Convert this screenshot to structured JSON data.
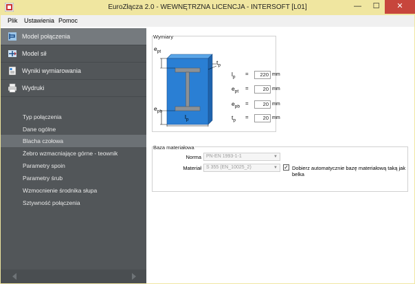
{
  "window": {
    "title": "EuroZłącza 2.0 - WEWNĘTRZNA LICENCJA - INTERSOFT [L01]",
    "minimize": "—",
    "maximize": "☐",
    "close": "✕"
  },
  "menu": [
    "Plik",
    "Ustawienia",
    "Pomoc"
  ],
  "sidebar": {
    "nav": [
      {
        "label": "Model połączenia",
        "icon": "connection-model-icon",
        "active": true
      },
      {
        "label": "Model sił",
        "icon": "forces-model-icon",
        "active": false
      },
      {
        "label": "Wyniki wymiarowania",
        "icon": "results-icon",
        "active": false
      },
      {
        "label": "Wydruki",
        "icon": "printer-icon",
        "active": false
      }
    ],
    "sub_items": [
      {
        "label": "Typ połączenia",
        "active": false
      },
      {
        "label": "Dane ogólne",
        "active": false
      },
      {
        "label": "Blacha czołowa",
        "active": true
      },
      {
        "label": "Żebro wzmacniające górne - teownik",
        "active": false
      },
      {
        "label": "Parametry spoin",
        "active": false
      },
      {
        "label": "Parametry śrub",
        "active": false
      },
      {
        "label": "Wzmocnienie środnika słupa",
        "active": false
      },
      {
        "label": "Sztywność połączenia",
        "active": false
      }
    ]
  },
  "dimensions": {
    "group_label": "Wymiary",
    "diagram_labels": {
      "ept_e": "e",
      "ept_sub": "pt",
      "epb_e": "e",
      "epb_sub": "pb",
      "tp_t": "t",
      "tp_sub": "p",
      "lp_l": "l",
      "lp_sub": "p"
    },
    "params": [
      {
        "sym": "l",
        "sub": "p",
        "value": "220",
        "unit": "mm"
      },
      {
        "sym": "e",
        "sub": "pt",
        "value": "20",
        "unit": "mm"
      },
      {
        "sym": "e",
        "sub": "pb",
        "value": "20",
        "unit": "mm"
      },
      {
        "sym": "t",
        "sub": "p",
        "value": "20",
        "unit": "mm"
      }
    ],
    "eq": "="
  },
  "material": {
    "group_label": "Baza materiałowa",
    "norma_label": "Norma",
    "norma_value": "PN-EN 1993-1-1",
    "material_label": "Materiał",
    "material_value": "S 355 (EN_10025_2)",
    "auto_checkbox_label": "Dobierz automatycznie bazę materiałową taką jak belka",
    "auto_checked": true,
    "check_mark": "✓"
  },
  "colors": {
    "sidebar_bg": "#525659",
    "active_bg": "#757a7e",
    "plate_blue": "#2a7fd4",
    "titlebar": "#f0e6a0"
  }
}
